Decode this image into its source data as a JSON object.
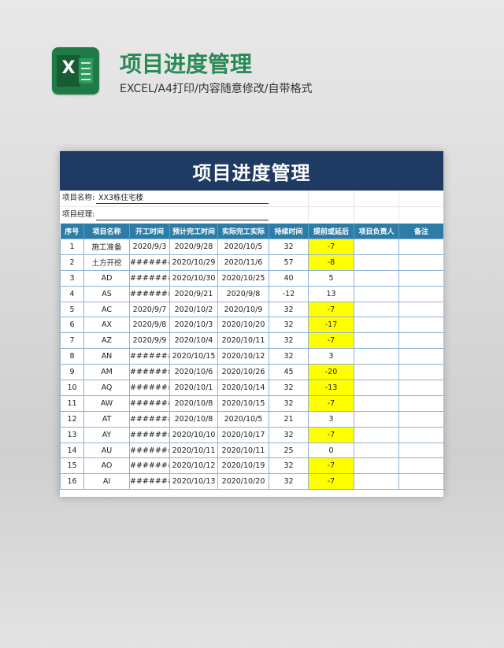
{
  "header": {
    "title": "项目进度管理",
    "subtitle": "EXCEL/A4打印/内容随意修改/自带格式"
  },
  "sheet": {
    "banner_title": "项目进度管理",
    "project_name_label": "项目名称:",
    "project_name_value": "XX3栋住宅楼",
    "manager_label": "项目经理:",
    "columns": [
      "序号",
      "项目名称",
      "开工时间",
      "预计完工时间",
      "实际完工实际",
      "持续时间",
      "提前或延后",
      "项目负责人",
      "备注"
    ],
    "highlight_color": "#ffff00",
    "rows": [
      {
        "no": "1",
        "name": "施工准备",
        "start": "2020/9/3",
        "planned": "2020/9/28",
        "actual": "2020/10/5",
        "duration": "32",
        "diff": "-7",
        "hl": true
      },
      {
        "no": "2",
        "name": "土方开挖",
        "start": "#######",
        "planned": "2020/10/29",
        "actual": "2020/11/6",
        "duration": "57",
        "diff": "-8",
        "hl": true
      },
      {
        "no": "3",
        "name": "AD",
        "start": "#######",
        "planned": "2020/10/30",
        "actual": "2020/10/25",
        "duration": "40",
        "diff": "5",
        "hl": false
      },
      {
        "no": "4",
        "name": "AS",
        "start": "#######",
        "planned": "2020/9/21",
        "actual": "2020/9/8",
        "duration": "-12",
        "diff": "13",
        "hl": false
      },
      {
        "no": "5",
        "name": "AC",
        "start": "2020/9/7",
        "planned": "2020/10/2",
        "actual": "2020/10/9",
        "duration": "32",
        "diff": "-7",
        "hl": true
      },
      {
        "no": "6",
        "name": "AX",
        "start": "2020/9/8",
        "planned": "2020/10/3",
        "actual": "2020/10/20",
        "duration": "32",
        "diff": "-17",
        "hl": true
      },
      {
        "no": "7",
        "name": "AZ",
        "start": "2020/9/9",
        "planned": "2020/10/4",
        "actual": "2020/10/11",
        "duration": "32",
        "diff": "-7",
        "hl": true
      },
      {
        "no": "8",
        "name": "AN",
        "start": "#######",
        "planned": "2020/10/15",
        "actual": "2020/10/12",
        "duration": "32",
        "diff": "3",
        "hl": false
      },
      {
        "no": "9",
        "name": "AM",
        "start": "#######",
        "planned": "2020/10/6",
        "actual": "2020/10/26",
        "duration": "45",
        "diff": "-20",
        "hl": true
      },
      {
        "no": "10",
        "name": "AQ",
        "start": "#######",
        "planned": "2020/10/1",
        "actual": "2020/10/14",
        "duration": "32",
        "diff": "-13",
        "hl": true
      },
      {
        "no": "11",
        "name": "AW",
        "start": "#######",
        "planned": "2020/10/8",
        "actual": "2020/10/15",
        "duration": "32",
        "diff": "-7",
        "hl": true
      },
      {
        "no": "12",
        "name": "AT",
        "start": "#######",
        "planned": "2020/10/8",
        "actual": "2020/10/5",
        "duration": "21",
        "diff": "3",
        "hl": false
      },
      {
        "no": "13",
        "name": "AY",
        "start": "#######",
        "planned": "2020/10/10",
        "actual": "2020/10/17",
        "duration": "32",
        "diff": "-7",
        "hl": true
      },
      {
        "no": "14",
        "name": "AU",
        "start": "#######",
        "planned": "2020/10/11",
        "actual": "2020/10/11",
        "duration": "25",
        "diff": "0",
        "hl": false
      },
      {
        "no": "15",
        "name": "AO",
        "start": "#######",
        "planned": "2020/10/12",
        "actual": "2020/10/19",
        "duration": "32",
        "diff": "-7",
        "hl": true
      },
      {
        "no": "16",
        "name": "AI",
        "start": "#######",
        "planned": "2020/10/13",
        "actual": "2020/10/20",
        "duration": "32",
        "diff": "-7",
        "hl": true
      }
    ]
  }
}
